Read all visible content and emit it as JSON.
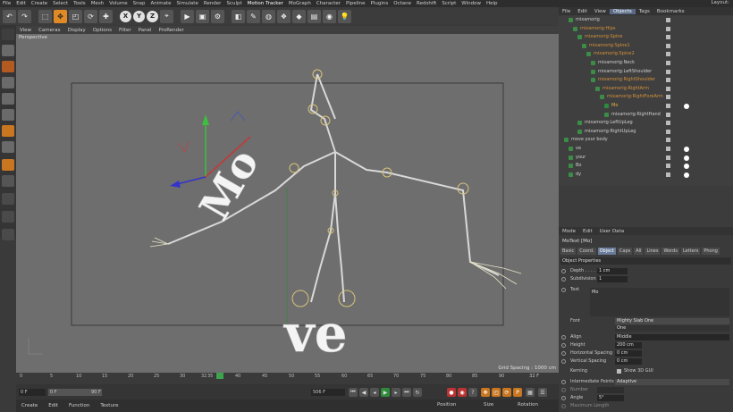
{
  "menubar": [
    "File",
    "Edit",
    "Create",
    "Select",
    "Tools",
    "Mesh",
    "Volume",
    "Snap",
    "Animate",
    "Simulate",
    "Render",
    "Sculpt",
    "Motion Tracker",
    "MoGraph",
    "Character",
    "Pipeline",
    "Plugins",
    "Octane",
    "Redshift",
    "Script",
    "Window",
    "Help"
  ],
  "layout_label": "Layout:",
  "toolbar": {
    "undo": "↶",
    "axis_x": "X",
    "axis_y": "Y",
    "axis_z": "Z"
  },
  "viewport_menu": [
    "View",
    "Cameras",
    "Display",
    "Options",
    "Filter",
    "Panel",
    "ProRender"
  ],
  "viewport": {
    "label": "Perspective",
    "grid_spacing": "Grid Spacing : 1000 cm",
    "text_mo": "Mo",
    "text_ve": "ve"
  },
  "timeline": {
    "ticks": [
      "0",
      "5",
      "10",
      "15",
      "20",
      "25",
      "30",
      "32",
      "35",
      "40",
      "45",
      "50",
      "55",
      "60",
      "65",
      "70",
      "75",
      "80",
      "85",
      "90"
    ],
    "current_frame_end": "32 F"
  },
  "transport": {
    "start": "0 F",
    "range_start": "0 F",
    "range_end": "90 F",
    "frame_field": "506 F"
  },
  "bottombar": [
    "Create",
    "Edit",
    "Function",
    "Texture"
  ],
  "coordbar": {
    "position": "Position",
    "size": "Size",
    "rotation": "Rotation"
  },
  "object_manager": {
    "menu": [
      "File",
      "Edit",
      "View",
      "Objects",
      "Tags",
      "Bookmarks"
    ],
    "rows": [
      {
        "name": "mixamorig",
        "indent": 1,
        "cls": "wht"
      },
      {
        "name": "mixamorig:Hips",
        "indent": 2,
        "cls": "bone"
      },
      {
        "name": "mixamorig:Spine",
        "indent": 3,
        "cls": "bone"
      },
      {
        "name": "mixamorig:Spine1",
        "indent": 4,
        "cls": "bone"
      },
      {
        "name": "mixamorig:Spine2",
        "indent": 5,
        "cls": "bone"
      },
      {
        "name": "mixamorig:Neck",
        "indent": 6,
        "cls": "wht"
      },
      {
        "name": "mixamorig:LeftShoulder",
        "indent": 6,
        "cls": "wht"
      },
      {
        "name": "mixamorig:RightShoulder",
        "indent": 6,
        "cls": "bone"
      },
      {
        "name": "mixamorig:RightArm",
        "indent": 7,
        "cls": "bone"
      },
      {
        "name": "mixamorig:RightForeArm",
        "indent": 8,
        "cls": "bone"
      },
      {
        "name": "Mo",
        "indent": 9,
        "cls": "yel",
        "tag": true
      },
      {
        "name": "mixamorig:RightHand",
        "indent": 9,
        "cls": "wht"
      },
      {
        "name": "mixamorig:LeftUpLeg",
        "indent": 3,
        "cls": "wht"
      },
      {
        "name": "mixamorig:RightUpLeg",
        "indent": 3,
        "cls": "wht"
      },
      {
        "name": "move your body",
        "indent": 0,
        "cls": "wht"
      },
      {
        "name": "ve",
        "indent": 1,
        "cls": "wht",
        "tag": true
      },
      {
        "name": "your",
        "indent": 1,
        "cls": "wht",
        "tag": true
      },
      {
        "name": "Bo",
        "indent": 1,
        "cls": "wht",
        "tag": true
      },
      {
        "name": "dy",
        "indent": 1,
        "cls": "wht",
        "tag": true
      }
    ]
  },
  "attribute_manager": {
    "menu": [
      "Mode",
      "Edit",
      "User Data"
    ],
    "title": "MoText [Mo]",
    "tabs": [
      "Basic",
      "Coord.",
      "Object",
      "Caps",
      "All",
      "Lines",
      "Words",
      "Letters",
      "Phong"
    ],
    "section": "Object Properties",
    "depth_label": "Depth . . . . .",
    "depth": "1 cm",
    "subdiv_label": "Subdivision",
    "subdiv": "1",
    "text_label": "Text",
    "text": "Mo",
    "font_label": "Font",
    "font": "Mighty Slab One",
    "font_style": "One",
    "align_label": "Align",
    "align": "Middle",
    "height_label": "Height",
    "height": "200 cm",
    "hspacing_label": "Horizontal Spacing",
    "hspacing": "0 cm",
    "vspacing_label": "Vertical Spacing",
    "vspacing": "0 cm",
    "kerning_label": "Kerning",
    "show3d": "Show 3D GUI",
    "ip_label": "Intermediate Points",
    "ip": "Adaptive",
    "number_label": "Number",
    "angle_label": "Angle",
    "angle": "5°",
    "maxlen_label": "Maximum Length"
  },
  "colors": {
    "accent": "#e08a26",
    "bone": "#d6913a",
    "viewport": "#6e6e6e"
  }
}
